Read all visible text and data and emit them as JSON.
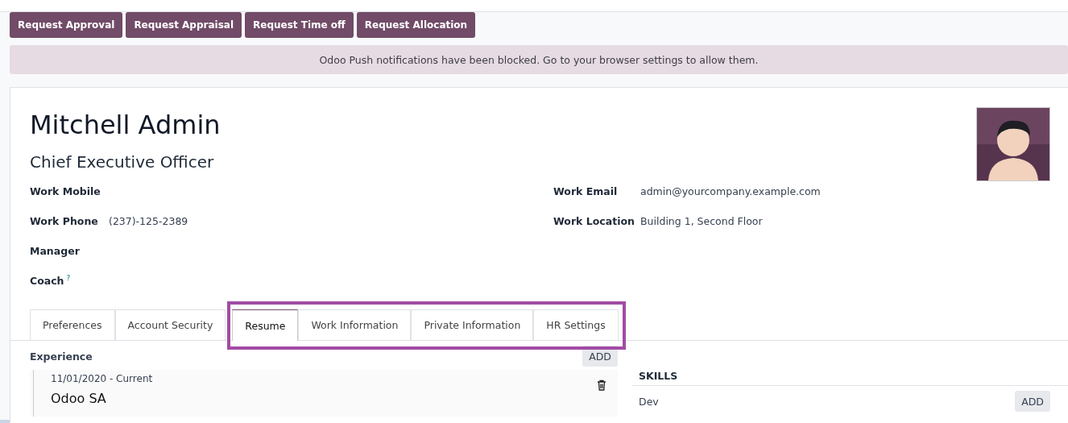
{
  "action_buttons": [
    "Request Approval",
    "Request Appraisal",
    "Request Time off",
    "Request Allocation"
  ],
  "notice": "Odoo Push notifications have been blocked. Go to your browser settings to allow them.",
  "employee": {
    "name": "Mitchell Admin",
    "job_title": "Chief Executive Officer"
  },
  "fields_left": [
    {
      "label": "Work Mobile"
    },
    {
      "label": "Work Phone",
      "value": "(237)-125-2389"
    },
    {
      "label": "Manager"
    },
    {
      "label": "Coach",
      "help": "?"
    }
  ],
  "fields_right": [
    {
      "label": "Work Email",
      "value": "admin@yourcompany.example.com"
    },
    {
      "label": "Work Location",
      "value": "Building 1, Second Floor"
    }
  ],
  "tabs": [
    {
      "label": "Preferences",
      "selected": false,
      "highlighted": false
    },
    {
      "label": "Account Security",
      "selected": false,
      "highlighted": false
    },
    {
      "label": "Resume",
      "selected": true,
      "highlighted": true
    },
    {
      "label": "Work Information",
      "selected": false,
      "highlighted": true
    },
    {
      "label": "Private Information",
      "selected": false,
      "highlighted": true
    },
    {
      "label": "HR Settings",
      "selected": false,
      "highlighted": true
    }
  ],
  "resume": {
    "title": "Experience",
    "add_label": "ADD",
    "entries": [
      {
        "dates": "11/01/2020 - Current",
        "company": "Odoo SA"
      }
    ]
  },
  "skills": {
    "title": "SKILLS",
    "rows": [
      {
        "name": "Dev",
        "add_label": "ADD"
      }
    ]
  }
}
